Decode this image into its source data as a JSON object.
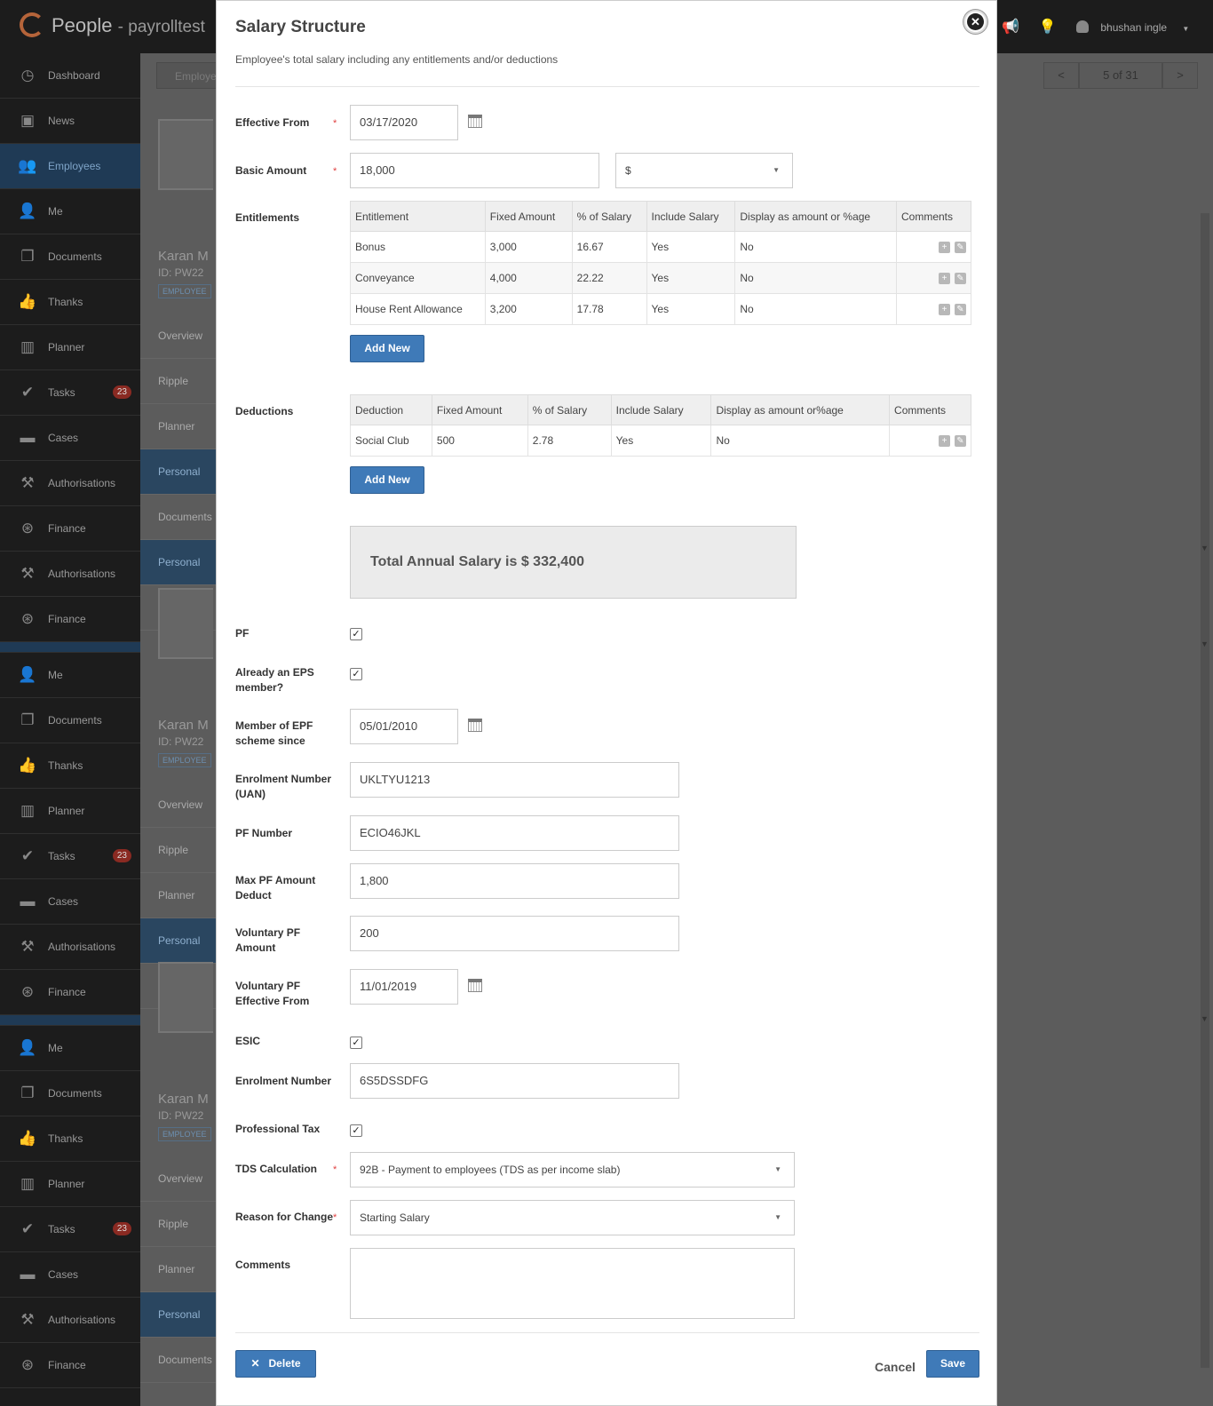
{
  "app": {
    "brand": "People",
    "company": "- payrolltest",
    "user": "bhushan ingle",
    "pager": {
      "prev": "<",
      "count": "5 of 31",
      "next": ">"
    },
    "breadcrumb": "Employe"
  },
  "sidebar": {
    "items": [
      {
        "label": "Dashboard",
        "icon": "dashboard-icon"
      },
      {
        "label": "News",
        "icon": "tv-icon"
      },
      {
        "label": "Employees",
        "icon": "people-icon",
        "active": true
      },
      {
        "label": "Me",
        "icon": "user-star-icon"
      },
      {
        "label": "Documents",
        "icon": "documents-icon"
      },
      {
        "label": "Thanks",
        "icon": "thumbs-up-icon"
      },
      {
        "label": "Planner",
        "icon": "planner-icon"
      },
      {
        "label": "Tasks",
        "icon": "check-icon",
        "badge": "23"
      },
      {
        "label": "Cases",
        "icon": "briefcase-icon"
      },
      {
        "label": "Authorisations",
        "icon": "gavel-icon"
      },
      {
        "label": "Finance",
        "icon": "finance-icon"
      },
      {
        "label": "Authorisations",
        "icon": "gavel-icon"
      },
      {
        "label": "Finance",
        "icon": "finance-icon"
      },
      {
        "label": "Me",
        "icon": "user-star-icon"
      },
      {
        "label": "Documents",
        "icon": "documents-icon"
      },
      {
        "label": "Thanks",
        "icon": "thumbs-up-icon"
      },
      {
        "label": "Planner",
        "icon": "planner-icon"
      },
      {
        "label": "Tasks",
        "icon": "check-icon",
        "badge": "23"
      },
      {
        "label": "Cases",
        "icon": "briefcase-icon"
      },
      {
        "label": "Authorisations",
        "icon": "gavel-icon"
      },
      {
        "label": "Finance",
        "icon": "finance-icon"
      },
      {
        "label": "Me",
        "icon": "user-star-icon"
      },
      {
        "label": "Documents",
        "icon": "documents-icon"
      },
      {
        "label": "Thanks",
        "icon": "thumbs-up-icon"
      },
      {
        "label": "Planner",
        "icon": "planner-icon"
      },
      {
        "label": "Tasks",
        "icon": "check-icon",
        "badge": "23"
      },
      {
        "label": "Cases",
        "icon": "briefcase-icon"
      },
      {
        "label": "Authorisations",
        "icon": "gavel-icon"
      },
      {
        "label": "Finance",
        "icon": "finance-icon"
      }
    ]
  },
  "background": {
    "employee_name": "Karan M",
    "employee_id": "ID: PW22",
    "tag": "EMPLOYEE",
    "tabs": [
      "Overview",
      "Ripple",
      "Planner",
      "Personal",
      "Documents",
      "Personal",
      "Documents"
    ]
  },
  "modal": {
    "title": "Salary Structure",
    "subtitle": "Employee's total salary including any entitlements and/or deductions",
    "effective_from": {
      "label": "Effective From",
      "value": "03/17/2020"
    },
    "basic_amount": {
      "label": "Basic Amount",
      "value": "18,000",
      "currency": "$"
    },
    "entitlements": {
      "label": "Entitlements",
      "headers": [
        "Entitlement",
        "Fixed Amount",
        "% of Salary",
        "Include Salary",
        "Display as amount or %age",
        "Comments"
      ],
      "rows": [
        [
          "Bonus",
          "3,000",
          "16.67",
          "Yes",
          "No"
        ],
        [
          "Conveyance",
          "4,000",
          "22.22",
          "Yes",
          "No"
        ],
        [
          "House Rent Allowance",
          "3,200",
          "17.78",
          "Yes",
          "No"
        ]
      ],
      "add_label": "Add New"
    },
    "deductions": {
      "label": "Deductions",
      "headers": [
        "Deduction",
        "Fixed Amount",
        "% of Salary",
        "Include Salary",
        "Display as amount or%age",
        "Comments"
      ],
      "rows": [
        [
          "Social Club",
          "500",
          "2.78",
          "Yes",
          "No"
        ]
      ],
      "add_label": "Add New"
    },
    "total": "Total Annual Salary is $ 332,400",
    "pf": {
      "label": "PF",
      "checked": true
    },
    "eps": {
      "label1": "Already an EPS",
      "label2": "member?",
      "checked": true
    },
    "epf_since": {
      "label1": "Member of EPF",
      "label2": "scheme since",
      "value": "05/01/2010"
    },
    "uan": {
      "label1": "Enrolment Number",
      "label2": "(UAN)",
      "value": "UKLTYU1213"
    },
    "pf_number": {
      "label": "PF Number",
      "value": "ECIO46JKL"
    },
    "max_pf": {
      "label1": "Max PF Amount",
      "label2": "Deduct",
      "value": "1,800"
    },
    "voluntary_pf": {
      "label1": "Voluntary PF",
      "label2": "Amount",
      "value": "200"
    },
    "voluntary_pf_from": {
      "label1": "Voluntary PF",
      "label2": "Effective From",
      "value": "11/01/2019"
    },
    "esic": {
      "label": "ESIC",
      "checked": true
    },
    "esic_number": {
      "label": "Enrolment Number",
      "value": "6S5DSSDFG"
    },
    "professional_tax": {
      "label": "Professional Tax",
      "checked": true
    },
    "tds": {
      "label": "TDS Calculation",
      "value": "92B - Payment to employees (TDS as per income slab)"
    },
    "reason": {
      "label": "Reason for Change",
      "value": "Starting Salary"
    },
    "comments": {
      "label": "Comments",
      "value": ""
    },
    "delete_label": "Delete",
    "cancel_label": "Cancel",
    "save_label": "Save",
    "required_mark": "*",
    "close_symbol": "✕",
    "check_symbol": "✓",
    "caret_symbol": "▼"
  }
}
